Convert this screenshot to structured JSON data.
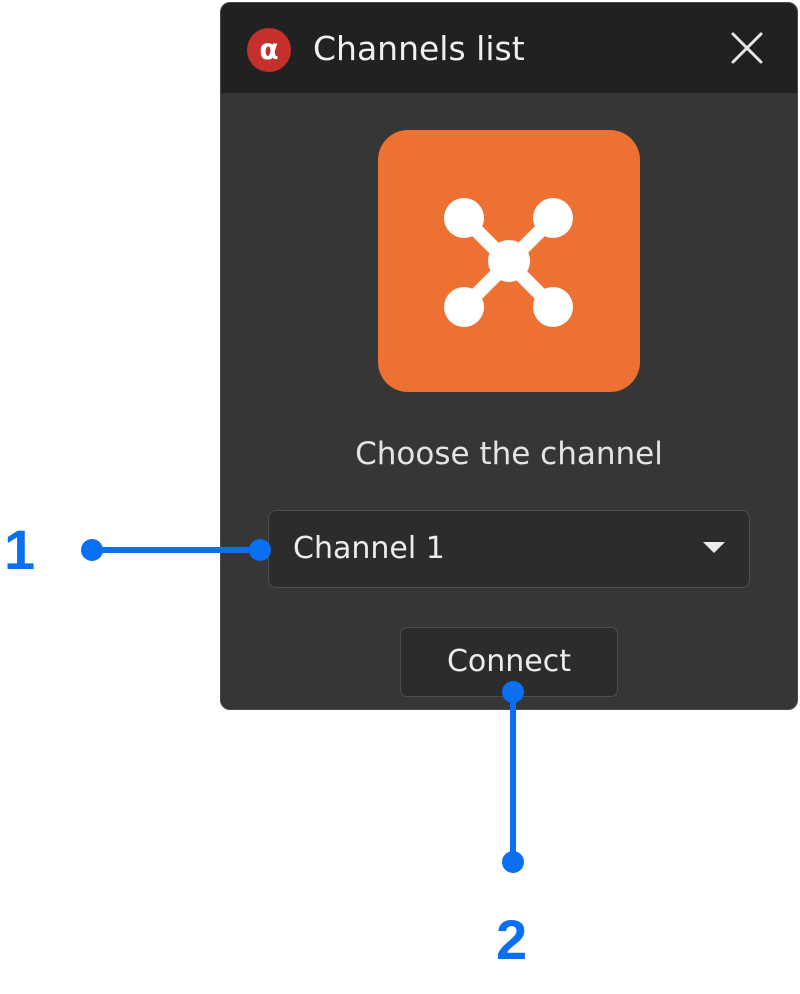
{
  "window": {
    "title": "Channels list",
    "app_icon": "α",
    "close_icon": "close-icon"
  },
  "main": {
    "hero_icon": "drone-icon",
    "prompt": "Choose the channel",
    "channel_select": {
      "value": "Channel 1"
    },
    "connect_label": "Connect"
  },
  "callouts": {
    "one": "1",
    "two": "2"
  },
  "colors": {
    "window_bg": "#363636",
    "titlebar_bg": "#212121",
    "accent_orange": "#ec7132",
    "app_icon_red": "#c4302b",
    "callout_blue": "#0a6ff0"
  }
}
